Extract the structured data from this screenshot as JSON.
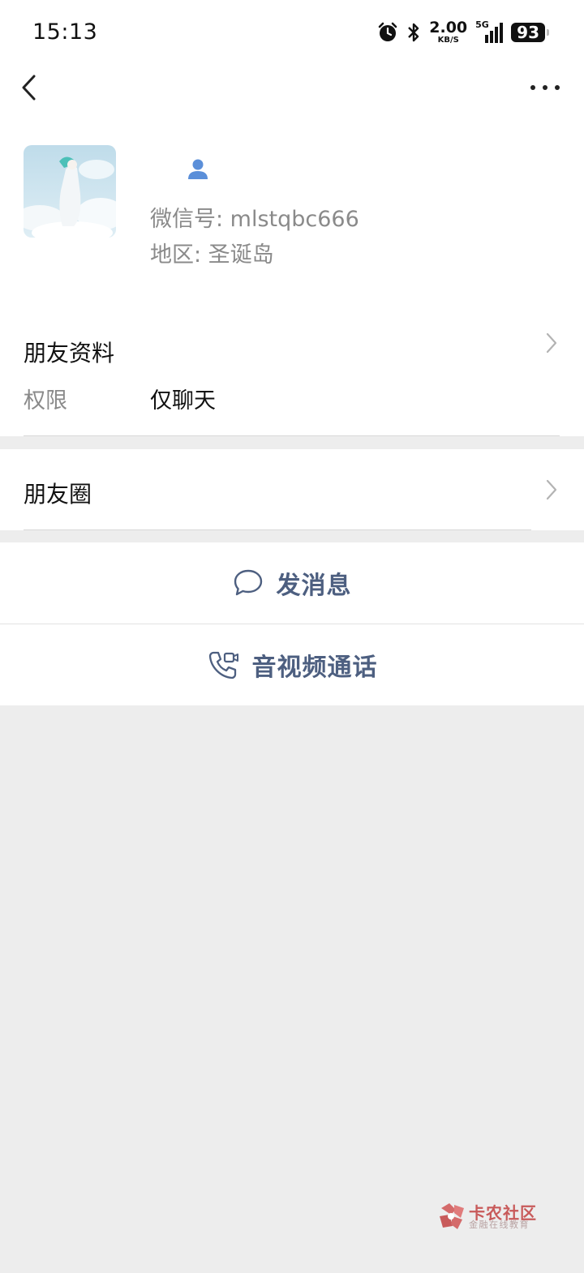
{
  "status_bar": {
    "time": "15:13",
    "net_speed_value": "2.00",
    "net_speed_unit": "KB/S",
    "network_type": "5G",
    "battery_level": "93",
    "icons": [
      "alarm-icon",
      "bluetooth-icon",
      "signal-icon",
      "battery-icon"
    ]
  },
  "header": {
    "back_icon": "chevron-left-icon",
    "more_icon": "more-dots-icon",
    "wechat_id_line": "微信号: mlstqbc666",
    "region_line": "地区: 圣诞岛"
  },
  "profile_section": {
    "title": "朋友资料",
    "permission_label": "权限",
    "permission_value": "仅聊天"
  },
  "moments_section": {
    "title": "朋友圈"
  },
  "actions": {
    "send_message": "发消息",
    "video_call": "音视频通话"
  },
  "watermark": {
    "title": "卡农社区",
    "subtitle": "金融在线教育"
  },
  "colors": {
    "accent_text": "#4d5f80",
    "background": "#ededed",
    "person_icon": "#5b8fd9"
  }
}
